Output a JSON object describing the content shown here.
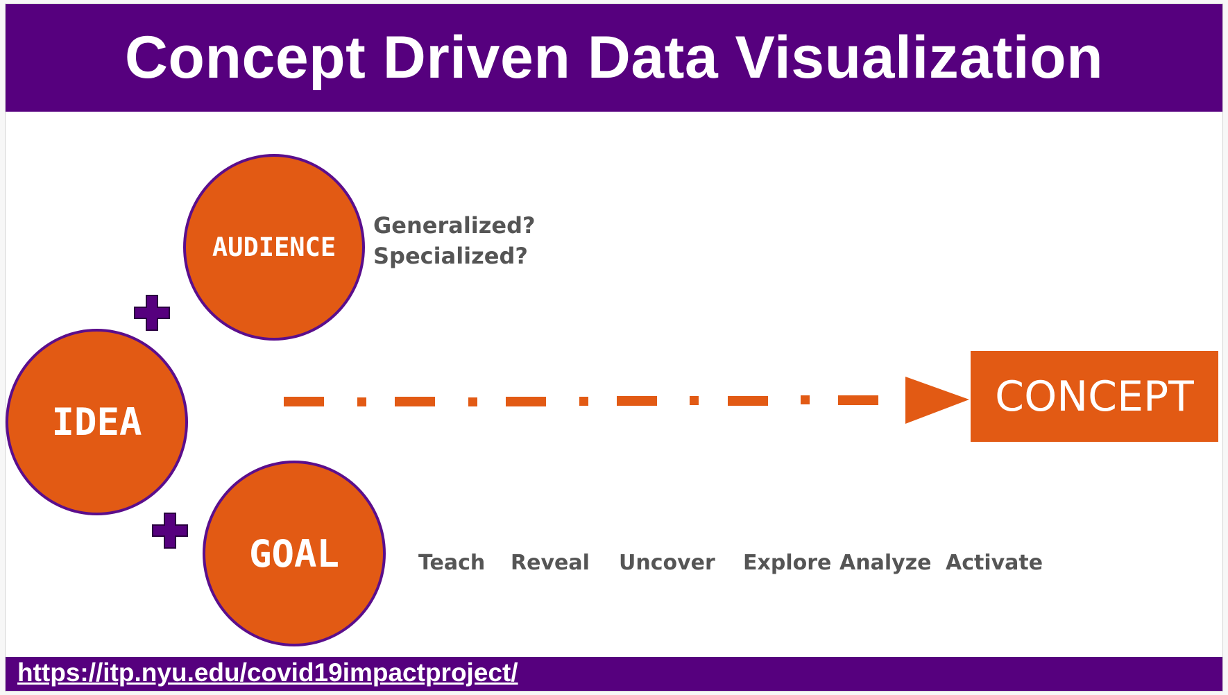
{
  "title": "Concept Driven Data Visualization",
  "footer": {
    "link_text": "https://itp.nyu.edu/covid19impactproject/"
  },
  "nodes": {
    "audience": "AUDIENCE",
    "idea": "IDEA",
    "goal": "GOAL",
    "concept": "CONCEPT"
  },
  "audience_questions": [
    "Generalized?",
    "Specialized?"
  ],
  "goal_types": [
    "Teach",
    "Reveal",
    "Uncover",
    "Explore",
    "Analyze",
    "Activate"
  ],
  "colors": {
    "purple": "#56007e",
    "orange": "#e25a14",
    "gray_text": "#555555"
  },
  "icons": [
    "plus-icon",
    "dash-dot-arrow"
  ]
}
